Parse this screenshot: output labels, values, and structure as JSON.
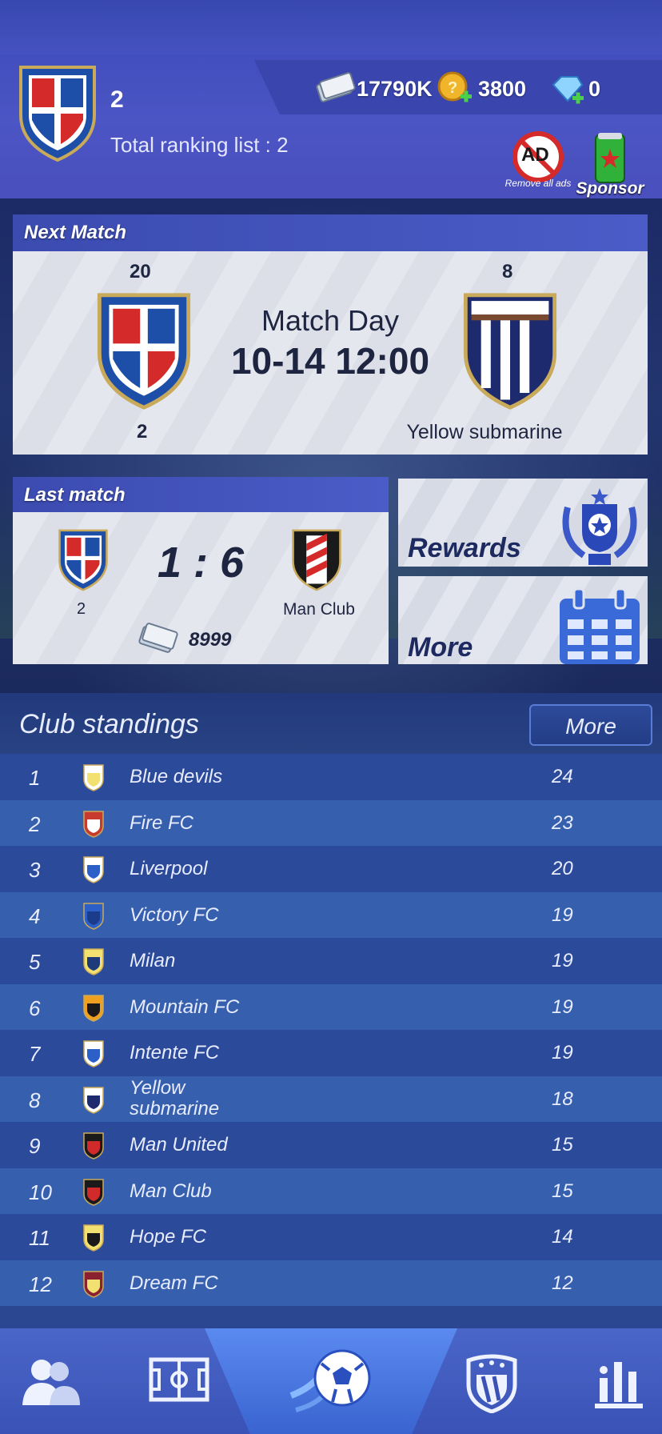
{
  "header": {
    "club_name": "2",
    "ranking_label": "Total ranking list : 2",
    "cash": "17790K",
    "coins": "3800",
    "gems": "0",
    "remove_ads_label": "Remove all ads",
    "ad_badge": "AD",
    "sponsor_label": "Sponsor"
  },
  "next_match": {
    "title": "Next Match",
    "home_rank": "20",
    "home_name": "2",
    "match_day_label": "Match Day",
    "datetime": "10-14 12:00",
    "away_rank": "8",
    "away_name": "Yellow submarine"
  },
  "last_match": {
    "title": "Last match",
    "home_name": "2",
    "score": "1 : 6",
    "away_name": "Man Club",
    "reward": "8999"
  },
  "side_buttons": {
    "rewards": "Rewards",
    "more": "More"
  },
  "standings": {
    "title": "Club standings",
    "more_label": "More",
    "rows": [
      {
        "rank": "1",
        "name": "Blue devils",
        "points": "24",
        "c1": "#ffffff",
        "c2": "#f2e070"
      },
      {
        "rank": "2",
        "name": "Fire FC",
        "points": "23",
        "c1": "#c83a2e",
        "c2": "#ffffff"
      },
      {
        "rank": "3",
        "name": "Liverpool",
        "points": "20",
        "c1": "#ffffff",
        "c2": "#2c5fc8"
      },
      {
        "rank": "4",
        "name": "Victory FC",
        "points": "19",
        "c1": "#2c5fc8",
        "c2": "#1a3c8a"
      },
      {
        "rank": "5",
        "name": "Milan",
        "points": "19",
        "c1": "#f2e070",
        "c2": "#1d3a7a"
      },
      {
        "rank": "6",
        "name": "Mountain FC",
        "points": "19",
        "c1": "#f0a020",
        "c2": "#1a1a1a"
      },
      {
        "rank": "7",
        "name": "Intente FC",
        "points": "19",
        "c1": "#ffffff",
        "c2": "#2c5fc8"
      },
      {
        "rank": "8",
        "name": "Yellow submarine",
        "points": "18",
        "c1": "#ffffff",
        "c2": "#1d2a6e"
      },
      {
        "rank": "9",
        "name": "Man United",
        "points": "15",
        "c1": "#1a1a1a",
        "c2": "#d02a2a"
      },
      {
        "rank": "10",
        "name": "Man Club",
        "points": "15",
        "c1": "#1a1a1a",
        "c2": "#d02a2a"
      },
      {
        "rank": "11",
        "name": "Hope FC",
        "points": "14",
        "c1": "#f2e070",
        "c2": "#1a1a1a"
      },
      {
        "rank": "12",
        "name": "Dream FC",
        "points": "12",
        "c1": "#8a2030",
        "c2": "#f2e070"
      }
    ]
  },
  "nav": {
    "items": [
      "team-icon",
      "pitch-icon",
      "play-icon",
      "club-icon",
      "stats-icon"
    ]
  }
}
